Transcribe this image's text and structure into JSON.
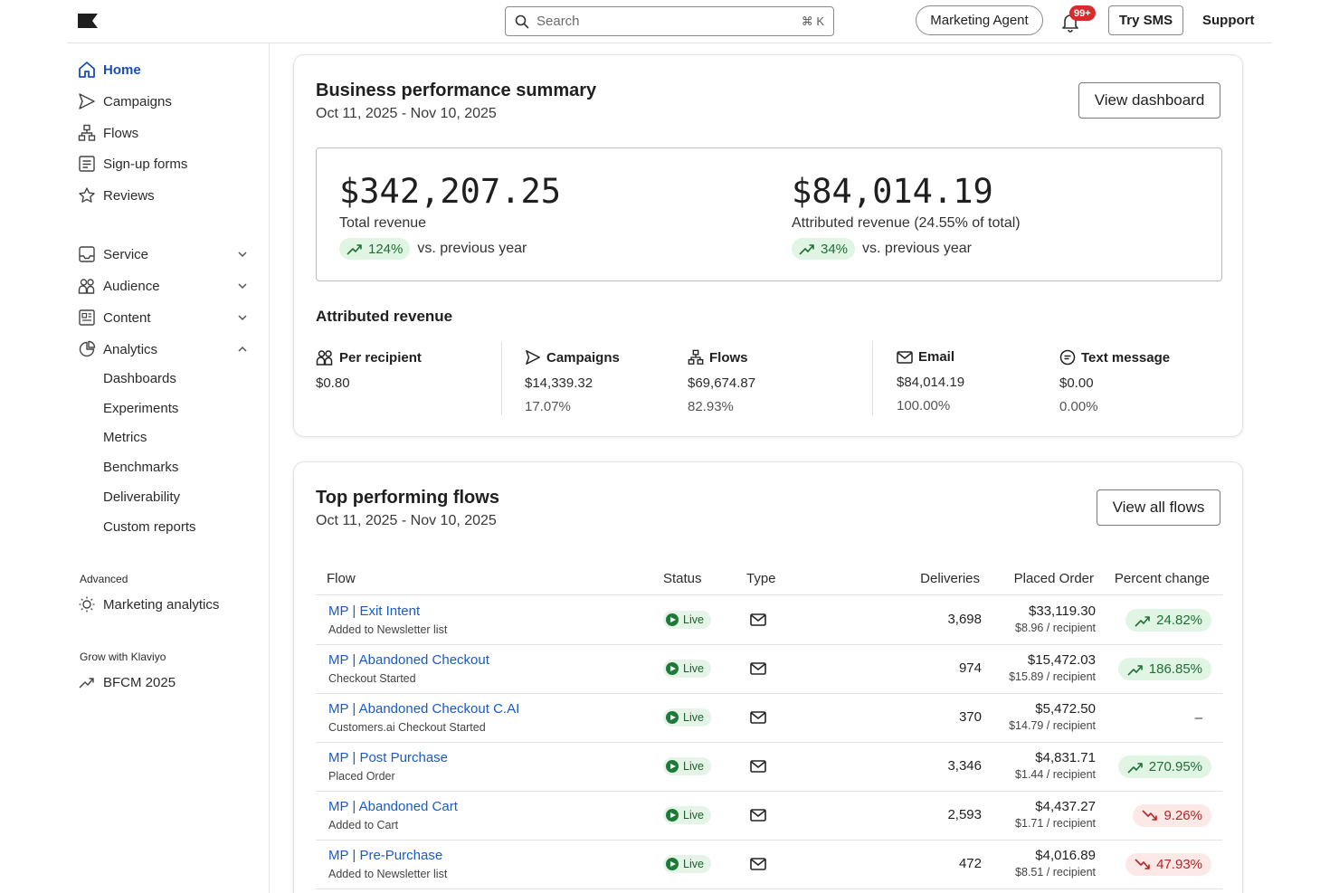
{
  "topbar": {
    "search_placeholder": "Search",
    "search_shortcut": "⌘ K",
    "marketing_agent": "Marketing Agent",
    "notifications_badge": "99+",
    "try_sms": "Try SMS",
    "support": "Support"
  },
  "sidebar": {
    "primary": [
      "Home",
      "Campaigns",
      "Flows",
      "Sign-up forms",
      "Reviews"
    ],
    "groups": [
      "Service",
      "Audience",
      "Content",
      "Analytics"
    ],
    "analytics_items": [
      "Dashboards",
      "Experiments",
      "Metrics",
      "Benchmarks",
      "Deliverability",
      "Custom reports"
    ],
    "advanced_label": "Advanced",
    "advanced_item": "Marketing analytics",
    "grow_label": "Grow with Klaviyo",
    "grow_item": "BFCM 2025"
  },
  "summary": {
    "title": "Business performance summary",
    "date_range": "Oct 11, 2025 - Nov 10, 2025",
    "view_dashboard": "View dashboard",
    "total_revenue": "$342,207.25",
    "total_label": "Total revenue",
    "total_change": "124%",
    "total_change_suffix": "vs. previous year",
    "attributed_revenue": "$84,014.19",
    "attributed_label": "Attributed revenue (24.55% of total)",
    "attributed_change": "34%",
    "attributed_change_suffix": "vs. previous year",
    "attributed_title": "Attributed revenue",
    "metrics": [
      {
        "label": "Per recipient",
        "value": "$0.80",
        "pct": ""
      },
      {
        "label": "Campaigns",
        "value": "$14,339.32",
        "pct": "17.07%"
      },
      {
        "label": "Flows",
        "value": "$69,674.87",
        "pct": "82.93%"
      },
      {
        "label": "Email",
        "value": "$84,014.19",
        "pct": "100.00%"
      },
      {
        "label": "Text message",
        "value": "$0.00",
        "pct": "0.00%"
      }
    ]
  },
  "flows": {
    "title": "Top performing flows",
    "date_range": "Oct 11, 2025 - Nov 10, 2025",
    "view_all": "View all flows",
    "columns": [
      "Flow",
      "Status",
      "Type",
      "Deliveries",
      "Placed Order",
      "Percent change"
    ],
    "rows": [
      {
        "name": "MP | Exit Intent",
        "trigger": "Added to Newsletter list",
        "status": "Live",
        "deliveries": "3,698",
        "order": "$33,119.30",
        "per": "$8.96 / recipient",
        "change": "24.82%",
        "dir": "up"
      },
      {
        "name": "MP | Abandoned Checkout",
        "trigger": "Checkout Started",
        "status": "Live",
        "deliveries": "974",
        "order": "$15,472.03",
        "per": "$15.89 / recipient",
        "change": "186.85%",
        "dir": "up"
      },
      {
        "name": "MP | Abandoned Checkout C.AI",
        "trigger": "Customers.ai Checkout Started",
        "status": "Live",
        "deliveries": "370",
        "order": "$5,472.50",
        "per": "$14.79 / recipient",
        "change": "–",
        "dir": "none"
      },
      {
        "name": "MP | Post Purchase",
        "trigger": "Placed Order",
        "status": "Live",
        "deliveries": "3,346",
        "order": "$4,831.71",
        "per": "$1.44 / recipient",
        "change": "270.95%",
        "dir": "up"
      },
      {
        "name": "MP | Abandoned Cart",
        "trigger": "Added to Cart",
        "status": "Live",
        "deliveries": "2,593",
        "order": "$4,437.27",
        "per": "$1.71 / recipient",
        "change": "9.26%",
        "dir": "down"
      },
      {
        "name": "MP | Pre-Purchase",
        "trigger": "Added to Newsletter list",
        "status": "Live",
        "deliveries": "472",
        "order": "$4,016.89",
        "per": "$8.51 / recipient",
        "change": "47.93%",
        "dir": "down"
      }
    ]
  },
  "icons": {
    "logo": "klaviyo-flag-icon",
    "trend_up": "trend-up-icon",
    "trend_down": "trend-down-icon",
    "live": "play-circle-icon",
    "type": "envelope-icon"
  },
  "colors": {
    "accent": "#1a4fb8",
    "link": "#1a5bc4",
    "up_bg": "#e0f5e4",
    "up_fg": "#1f6f36",
    "down_bg": "#fde8e8",
    "down_fg": "#b32424",
    "badge": "#d72c2c"
  }
}
